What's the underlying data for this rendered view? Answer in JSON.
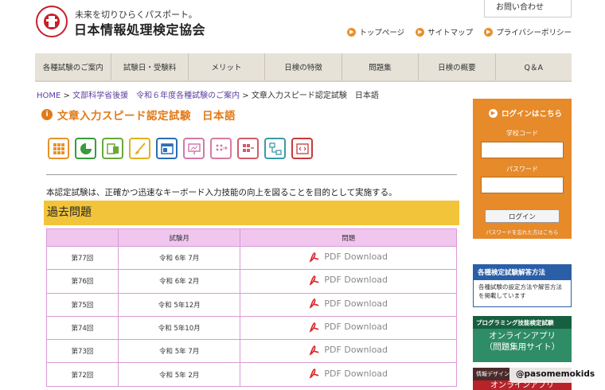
{
  "header": {
    "tagline": "未来を切りひらくパスポート。",
    "org_name": "日本情報処理検定協会",
    "contact_label": "お問い合わせ",
    "util_links": [
      "トップページ",
      "サイトマップ",
      "プライバシーポリシー"
    ]
  },
  "nav": {
    "items": [
      "各種試験のご案内",
      "試験日・受験料",
      "メリット",
      "日検の特徴",
      "問題集",
      "日検の概要",
      "Q＆A"
    ]
  },
  "breadcrumb": {
    "home": "HOME",
    "sep": ">",
    "crumb1": "文部科学省後援　令和６年度各種試験のご案内",
    "current": "文章入力スピード認定試験　日本語"
  },
  "page_title": "文章入力スピード認定試験　日本語",
  "category_icons": [
    {
      "name": "grid-icon",
      "color": "#e8912a"
    },
    {
      "name": "pie-chart-icon",
      "color": "#3b9a3b"
    },
    {
      "name": "spreadsheet-icon",
      "color": "#6aa83a"
    },
    {
      "name": "brush-icon",
      "color": "#e0b020"
    },
    {
      "name": "window-icon",
      "color": "#2a6db5"
    },
    {
      "name": "presentation-icon",
      "color": "#d478a8"
    },
    {
      "name": "flow-dots-icon",
      "color": "#d97aa0"
    },
    {
      "name": "flow-grid-icon",
      "color": "#d45a6a"
    },
    {
      "name": "diagram-icon",
      "color": "#3a9aa8"
    },
    {
      "name": "code-icon",
      "color": "#c83a3a"
    }
  ],
  "intro": "本認定試験は、正確かつ迅速なキーボード入力技能の向上を図ることを目的として実施する。",
  "section_title": "過去問題",
  "table": {
    "headers": [
      "",
      "試験月",
      "問題"
    ],
    "rows": [
      {
        "round": "第77回",
        "month": "令和 6年 7月",
        "download": "PDF Download"
      },
      {
        "round": "第76回",
        "month": "令和 6年 2月",
        "download": "PDF Download"
      },
      {
        "round": "第75回",
        "month": "令和 5年12月",
        "download": "PDF Download"
      },
      {
        "round": "第74回",
        "month": "令和 5年10月",
        "download": "PDF Download"
      },
      {
        "round": "第73回",
        "month": "令和 5年 7月",
        "download": "PDF Download"
      },
      {
        "round": "第72回",
        "month": "令和 5年 2月",
        "download": "PDF Download"
      }
    ]
  },
  "login": {
    "title": "ログインはこちら",
    "school_code_label": "学校コード",
    "password_label": "パスワード",
    "button": "ログイン",
    "forgot": "パスワードを忘れた方はこちら"
  },
  "sidebar": {
    "banner1_head": "各種検定試験解答方法",
    "banner1_body": "各種試験の設定方法や解答方法を掲載しています",
    "banner2_head": "プログラミング技能検定試験",
    "banner2_body_1": "オンラインアプリ",
    "banner2_body_2": "（問題集用サイト）",
    "banner3_head": "情報デザイン",
    "banner3_body": "オンラインアプリ"
  },
  "watermark": "@pasomemokids"
}
